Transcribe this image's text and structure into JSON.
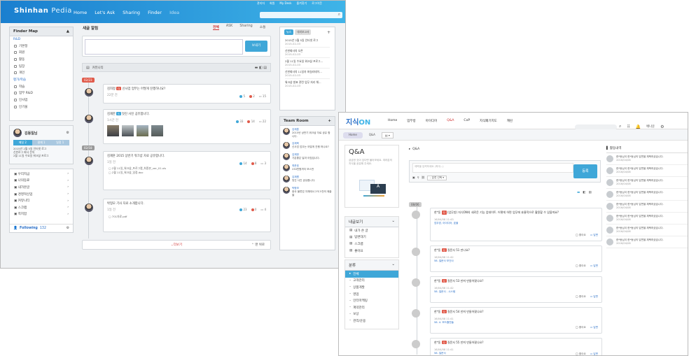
{
  "win1": {
    "logo_main": "Shinhan",
    "logo_sub": "Pedia",
    "nav": [
      "Home",
      "Let's Ask",
      "Sharing",
      "Finder",
      "Idea"
    ],
    "utility": [
      "관리자",
      "회원",
      "My Desk",
      "즐겨찾기",
      "로그아웃"
    ],
    "sidebar_title": "Finder Map",
    "sidebar_cat1": "R&D",
    "sidebar_items1": [
      "기본정",
      "회원",
      "활동",
      "팀장",
      "개인"
    ],
    "sidebar_cat2": "평가/학습",
    "sidebar_items2": [
      "학습",
      "업무 R&D",
      "인사업",
      "인기물"
    ],
    "profile_name": "김동일님",
    "profile_tabs": [
      "메일 2",
      "결재 1",
      "일정 1"
    ],
    "profile_text": [
      "2015년 2월 5일 인터넷 로그",
      "신한로그 회사 문의",
      "2월 11일 수요일 워크샵 프로그"
    ],
    "menu_items": [
      "우리지금",
      "나의동료",
      "내가본글",
      "경영혁신업",
      "커뮤니티",
      "스크랩",
      "쪽지함"
    ],
    "following_label": "Following",
    "following_count": "132",
    "section_title": "새글 알림",
    "tabs": [
      "전체",
      "ASK",
      "Sharing",
      "소통"
    ],
    "post_btn": "보내기",
    "community_label": "커뮤니티",
    "date1": "02/23",
    "date2": "02/18",
    "posts": [
      {
        "author": "김희정",
        "text": "신사업 업무는 어떻게 진행하나요?",
        "time": "22분 전",
        "likes": "5",
        "hearts": "2",
        "comments": "15"
      },
      {
        "author": "김재한",
        "text": "멋진 사진 공유합니다.",
        "time": "1시간 전",
        "likes": "33",
        "hearts": "14",
        "comments": "22"
      },
      {
        "author": "김재훈",
        "text": "2015 상반기 워크샵 자료 공유합니다.",
        "time": "1일 전",
        "likes": "14",
        "hearts": "8",
        "comments": "3"
      },
      {
        "author": "박형모",
        "text": "기사 자료 소개합니다.",
        "time": "1일 전",
        "likes": "23",
        "hearts": "0",
        "comments": "4"
      }
    ],
    "attach": [
      "2월 11일_워크샵_프로그램_최종본_ver_01.xls",
      "2월 11일_워크샵_일정.doc"
    ],
    "pdf": "701자료.pdf",
    "more": "더보기",
    "top": "맨 위로",
    "notice_tabs": [
      "뉴스",
      "대외보고서"
    ],
    "notices": [
      {
        "title": "2015년 2월 5일 인터넷 로그",
        "date": "2015-02-03"
      },
      {
        "title": "신한회사의 오픈",
        "date": "2015-02-03"
      },
      {
        "title": "2월 11일 수요일 워크샵 프로그...",
        "date": "2015-02-03"
      },
      {
        "title": "신한회사의 11일자 퍼실리테이...",
        "date": "2015-02-03"
      },
      {
        "title": "워크샵 발표 관련 업무 처리 해...",
        "date": "2015-02-03"
      }
    ],
    "teamroom_title": "Team Room",
    "team": [
      {
        "name": "김재훈",
        "text": "2015년 상반기 워크샵 자료 공유 합니다."
      },
      {
        "name": "김재욱",
        "text": "신사업 업무는 어떻게 진행 하나요?"
      },
      {
        "name": "김재한",
        "text": "기분좋은 달과 아침입니다."
      },
      {
        "name": "최준호",
        "text": "230만원까지 보스만"
      },
      {
        "name": "김재원",
        "text": "멋진 사진 공유합니다."
      },
      {
        "name": "박형모",
        "text": "중국 물류업 자체에서 2억 5천의 매출을"
      }
    ]
  },
  "win2": {
    "logo_main": "지식",
    "logo_sub": "ON",
    "nav": [
      "Home",
      "업무방",
      "아이디어",
      "Q&A",
      "CoP",
      "지식폐기지도",
      "캐린"
    ],
    "user": "배나운",
    "breadcrumb": [
      "Home",
      "Q&A"
    ],
    "title": "Q&A",
    "title_desc": "궁금한 것이 있다면 물어보세요. 여러분의 지식을 공유해 주세요.",
    "crumb": "Q&A",
    "input_placeholder": "제목을 입력하세요 (최대...)",
    "submit": "등록",
    "select": "분류 선택",
    "my_title": "내글보기",
    "my_items": [
      "내가 쓴 글",
      "답변대기",
      "스크랩",
      "좋아요"
    ],
    "cat_title": "분류",
    "cat_items": [
      "전체",
      "고객관리",
      "상품개발",
      "영업",
      "인터마케팅",
      "계약관리",
      "보상",
      "관리/운용"
    ],
    "date": "08/06",
    "qs": [
      {
        "author": "한*동",
        "text": "(업무방) 지식ON의 새로운 기능 업데이트. 어떻게 하면 업무에 효율적으로 활용할 수 있을까요?",
        "time": "16/04/08 11:43",
        "tag": "업무방, 아이디어, 효율",
        "a": "답변"
      },
      {
        "author": "한*동",
        "text": "질문사 51 만나요?",
        "time": "16/04/08 11:42",
        "tag": "58. 질문사 보건사",
        "a": "답변"
      },
      {
        "author": "한*동",
        "text": "질문사 53 만져 만들어졌나요?",
        "time": "16/04/08 11:42",
        "tag": "58. 질문사 . 시스템",
        "a": "답변"
      },
      {
        "author": "한*동",
        "text": "질문사 54 만져 만들어졌나요?",
        "time": "16/04/08 11:41",
        "tag": "58. 4. 보드줄만들",
        "a": "답변"
      },
      {
        "author": "한*동",
        "text": "질문사 55 만져 만들어졌나요?",
        "time": "16/04/08 11:41",
        "tag": "58. 질문사",
        "a": "답변"
      }
    ],
    "activity_title": "활동내역",
    "activity": [
      {
        "text": "한*동님이 한*동님의 답변을 채택하셨습니다.",
        "date": "2016/04/08"
      },
      {
        "text": "한*동님이 한*동님의 답변을 채택하셨습니다.",
        "date": "2016/04/08"
      },
      {
        "text": "한*동님이 한*동님의 답변을 채택하셨습니다.",
        "date": "2016/04/08"
      },
      {
        "text": "한*동님이 한*동님의 답변을 채택하셨습니다.",
        "date": "2016/04/08"
      },
      {
        "text": "한*동님이 한*동님의 답변을 채택하셨습니다.",
        "date": "2016/04/08"
      },
      {
        "text": "한*동님이 한*동님의 답변을 채택하셨습니다.",
        "date": "2016/04/08"
      },
      {
        "text": "한*동님이 한*동님의 답변을 채택하셨습니다.",
        "date": "2016/04/08"
      },
      {
        "text": "한*동님이 한*동님의 답변을 채택하셨습니다.",
        "date": "2016/04/08"
      }
    ]
  }
}
